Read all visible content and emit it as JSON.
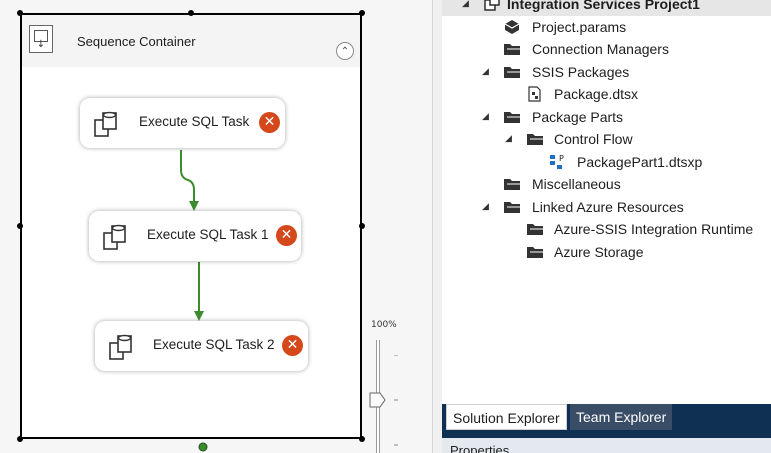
{
  "designer": {
    "container": {
      "title": "Sequence Container",
      "collapse_glyph": "⌃"
    },
    "tasks": [
      {
        "label": "Execute SQL Task",
        "error_glyph": "✕"
      },
      {
        "label": "Execute SQL Task 1",
        "error_glyph": "✕"
      },
      {
        "label": "Execute SQL Task 2",
        "error_glyph": "✕"
      }
    ],
    "zoom": {
      "label": "100%",
      "value_percent": 100
    }
  },
  "solution_explorer": {
    "tree": [
      {
        "label": "Integration Services Project1",
        "icon": "project-icon",
        "expand_glyph": "◢"
      },
      {
        "label": "Project.params",
        "icon": "params-icon",
        "expand_glyph": ""
      },
      {
        "label": "Connection Managers",
        "icon": "folder-icon",
        "expand_glyph": ""
      },
      {
        "label": "SSIS Packages",
        "icon": "folder-icon",
        "expand_glyph": "◢"
      },
      {
        "label": "Package.dtsx",
        "icon": "package-file-icon",
        "expand_glyph": ""
      },
      {
        "label": "Package Parts",
        "icon": "folder-icon",
        "expand_glyph": "◢"
      },
      {
        "label": "Control Flow",
        "icon": "folder-icon",
        "expand_glyph": "◢"
      },
      {
        "label": "PackagePart1.dtsxp",
        "icon": "package-part-icon",
        "expand_glyph": ""
      },
      {
        "label": "Miscellaneous",
        "icon": "folder-icon",
        "expand_glyph": ""
      },
      {
        "label": "Linked Azure Resources",
        "icon": "folder-icon",
        "expand_glyph": "◢"
      },
      {
        "label": "Azure-SSIS Integration Runtime",
        "icon": "folder-icon",
        "expand_glyph": ""
      },
      {
        "label": "Azure Storage",
        "icon": "folder-icon",
        "expand_glyph": ""
      }
    ],
    "tabs": [
      {
        "label": "Solution Explorer",
        "active": true
      },
      {
        "label": "Team Explorer",
        "active": false
      }
    ]
  },
  "properties": {
    "title": "Properties"
  },
  "colors": {
    "connector_green": "#3c8c2e",
    "error_red": "#d4481c",
    "tab_strip_navy": "#0f2f53"
  }
}
